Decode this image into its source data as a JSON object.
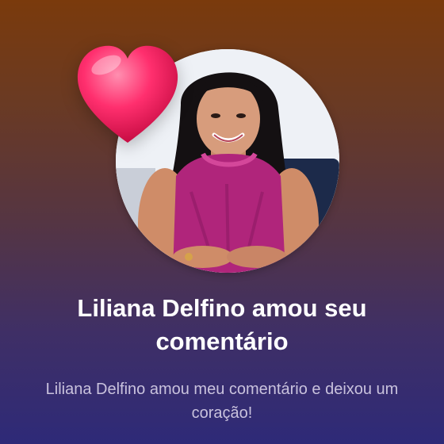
{
  "notification": {
    "title": "Liliana Delfino amou seu comentário",
    "message": "Liliana Delfino amou meu comentário e deixou um coração!",
    "avatar_icon": "user-photo",
    "reaction_icon": "heart-icon",
    "reaction_color": "#ff2f6e"
  }
}
